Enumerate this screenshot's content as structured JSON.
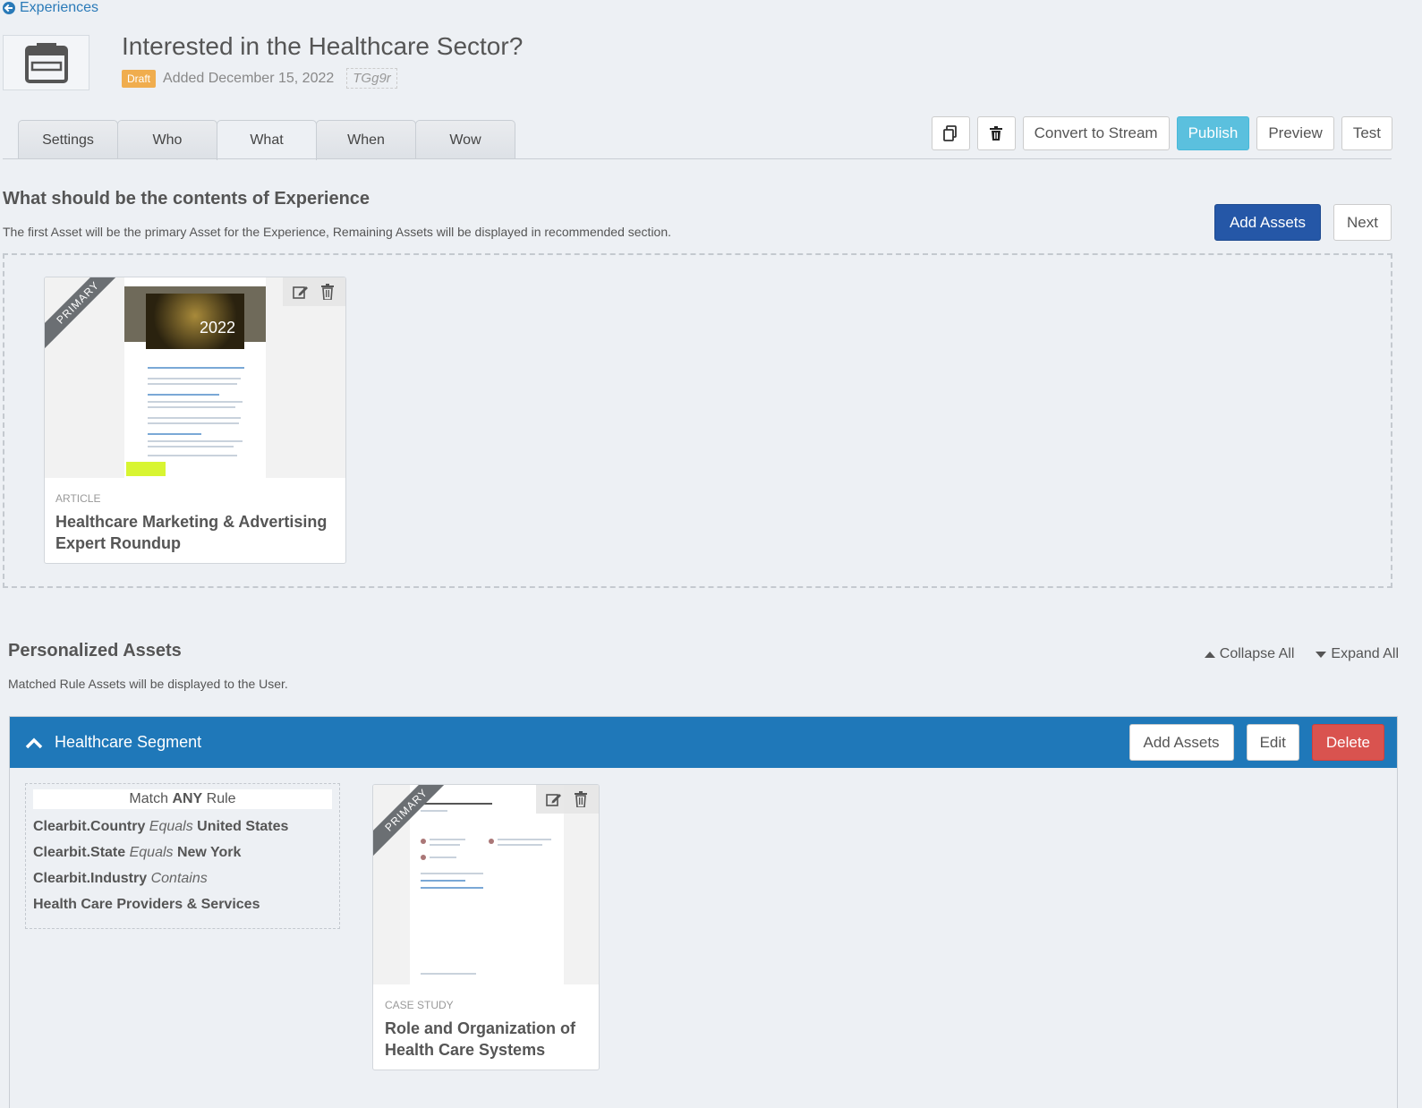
{
  "back_link": {
    "label": "Experiences"
  },
  "header": {
    "title": "Interested in the Healthcare Sector?",
    "status_badge": "Draft",
    "added_text": "Added December 15, 2022",
    "code": "TGg9r"
  },
  "tabs": [
    {
      "label": "Settings"
    },
    {
      "label": "Who"
    },
    {
      "label": "What",
      "active": true
    },
    {
      "label": "When"
    },
    {
      "label": "Wow"
    }
  ],
  "toolbar": {
    "duplicate_icon": "copy-icon",
    "delete_icon": "trash-icon",
    "convert_label": "Convert to Stream",
    "publish_label": "Publish",
    "preview_label": "Preview",
    "test_label": "Test"
  },
  "contents": {
    "title": "What should be the contents of Experience",
    "description": "The first Asset will be the primary Asset for the Experience, Remaining Assets will be displayed in recommended section.",
    "add_assets_label": "Add Assets",
    "next_label": "Next",
    "assets": [
      {
        "ribbon": "PRIMARY",
        "type": "ARTICLE",
        "title": "Healthcare Marketing & Advertising Expert Roundup",
        "preview_year": "2022"
      }
    ]
  },
  "personalized": {
    "title": "Personalized Assets",
    "description": "Matched Rule Assets will be displayed to the User.",
    "collapse_all": "Collapse All",
    "expand_all": "Expand All",
    "segments": [
      {
        "name": "Healthcare Segment",
        "add_assets_label": "Add Assets",
        "edit_label": "Edit",
        "delete_label": "Delete",
        "match": {
          "prefix": "Match",
          "mode": "ANY",
          "suffix": "Rule"
        },
        "rules": [
          {
            "field": "Clearbit.Country",
            "op": "Equals",
            "value": "United States"
          },
          {
            "field": "Clearbit.State",
            "op": "Equals",
            "value": "New York"
          },
          {
            "field": "Clearbit.Industry",
            "op": "Contains",
            "value": ""
          }
        ],
        "rule_continuation": "Health Care Providers & Services",
        "assets": [
          {
            "ribbon": "PRIMARY",
            "type": "CASE STUDY",
            "title": "Role and Organization of Health Care Systems"
          }
        ]
      }
    ]
  },
  "colors": {
    "segment_header": "#1f78b9",
    "publish": "#5bc0de",
    "add_assets_primary": "#2557a7",
    "delete": "#d9534f",
    "draft_badge": "#f0ad4e"
  }
}
